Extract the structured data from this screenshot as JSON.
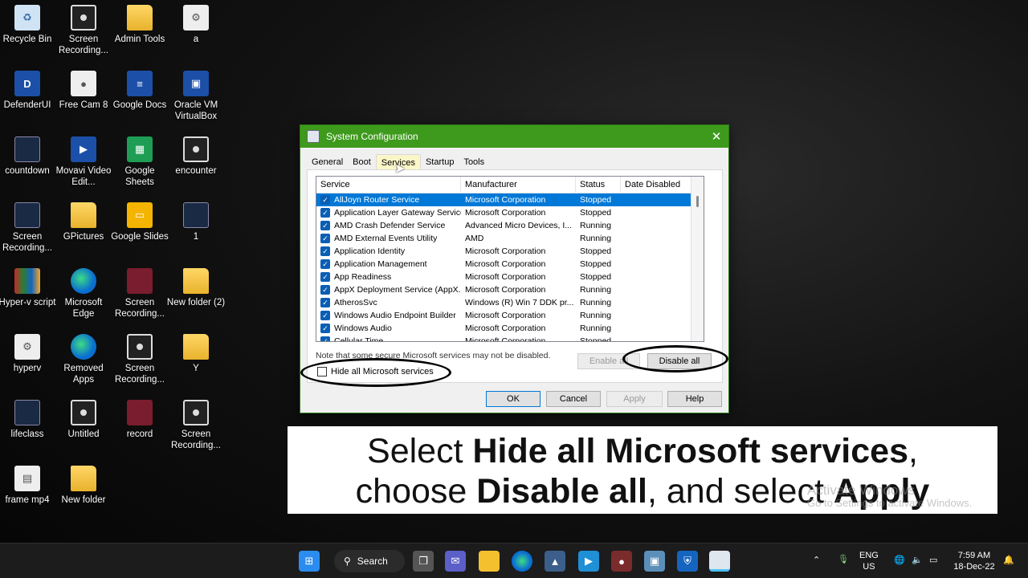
{
  "desktop": {
    "icons": [
      {
        "label": "Recycle Bin",
        "type": "bin",
        "glyph": "♻"
      },
      {
        "label": "Screen Recording...",
        "type": "film",
        "glyph": ""
      },
      {
        "label": "Admin Tools",
        "type": "folder",
        "glyph": ""
      },
      {
        "label": "a",
        "type": "gear",
        "glyph": "⚙"
      },
      {
        "label": "DefenderUI",
        "type": "blue",
        "glyph": "D"
      },
      {
        "label": "Free Cam 8",
        "type": "gear",
        "glyph": "●"
      },
      {
        "label": "Google Docs",
        "type": "blue",
        "glyph": "≡"
      },
      {
        "label": "Oracle VM VirtualBox",
        "type": "blue",
        "glyph": "▣"
      },
      {
        "label": "countdown",
        "type": "dark",
        "glyph": ""
      },
      {
        "label": "Movavi Video Edit...",
        "type": "blue",
        "glyph": "▶"
      },
      {
        "label": "Google Sheets",
        "type": "green",
        "glyph": "▦"
      },
      {
        "label": "encounter",
        "type": "film",
        "glyph": ""
      },
      {
        "label": "Screen Recording...",
        "type": "dark",
        "glyph": ""
      },
      {
        "label": "GPictures",
        "type": "folder",
        "glyph": ""
      },
      {
        "label": "Google Slides",
        "type": "yellow",
        "glyph": "▭"
      },
      {
        "label": "1",
        "type": "dark",
        "glyph": ""
      },
      {
        "label": "Hyper-v script",
        "type": "multi",
        "glyph": ""
      },
      {
        "label": "Microsoft Edge",
        "type": "edge",
        "glyph": ""
      },
      {
        "label": "Screen Recording...",
        "type": "red",
        "glyph": ""
      },
      {
        "label": "New folder (2)",
        "type": "folder",
        "glyph": ""
      },
      {
        "label": "hyperv",
        "type": "gear",
        "glyph": "⚙"
      },
      {
        "label": "Removed Apps",
        "type": "edge",
        "glyph": ""
      },
      {
        "label": "Screen Recording...",
        "type": "film",
        "glyph": ""
      },
      {
        "label": "Y",
        "type": "folder",
        "glyph": ""
      },
      {
        "label": "lifeclass",
        "type": "dark",
        "glyph": ""
      },
      {
        "label": "Untitled",
        "type": "film",
        "glyph": ""
      },
      {
        "label": "record",
        "type": "red",
        "glyph": ""
      },
      {
        "label": "Screen Recording...",
        "type": "film",
        "glyph": ""
      },
      {
        "label": "frame mp4",
        "type": "gear",
        "glyph": "▤"
      },
      {
        "label": "New folder",
        "type": "folder",
        "glyph": ""
      }
    ]
  },
  "dialog": {
    "title": "System Configuration",
    "close_glyph": "✕",
    "tabs": [
      "General",
      "Boot",
      "Services",
      "Startup",
      "Tools"
    ],
    "active_tab": "Services",
    "columns": [
      "Service",
      "Manufacturer",
      "Status",
      "Date Disabled"
    ],
    "rows": [
      {
        "service": "AllJoyn Router Service",
        "manufacturer": "Microsoft Corporation",
        "status": "Stopped"
      },
      {
        "service": "Application Layer Gateway Service",
        "manufacturer": "Microsoft Corporation",
        "status": "Stopped"
      },
      {
        "service": "AMD Crash Defender Service",
        "manufacturer": "Advanced Micro Devices, I...",
        "status": "Running"
      },
      {
        "service": "AMD External Events Utility",
        "manufacturer": "AMD",
        "status": "Running"
      },
      {
        "service": "Application Identity",
        "manufacturer": "Microsoft Corporation",
        "status": "Stopped"
      },
      {
        "service": "Application Management",
        "manufacturer": "Microsoft Corporation",
        "status": "Stopped"
      },
      {
        "service": "App Readiness",
        "manufacturer": "Microsoft Corporation",
        "status": "Stopped"
      },
      {
        "service": "AppX Deployment Service (AppX...",
        "manufacturer": "Microsoft Corporation",
        "status": "Running"
      },
      {
        "service": "AtherosSvc",
        "manufacturer": "Windows (R) Win 7 DDK pr...",
        "status": "Running"
      },
      {
        "service": "Windows Audio Endpoint Builder",
        "manufacturer": "Microsoft Corporation",
        "status": "Running"
      },
      {
        "service": "Windows Audio",
        "manufacturer": "Microsoft Corporation",
        "status": "Running"
      },
      {
        "service": "Cellular Time",
        "manufacturer": "Microsoft Corporation",
        "status": "Stopped"
      }
    ],
    "note": "Note that some secure Microsoft services may not be disabled.",
    "hide_ms_label": "Hide all Microsoft services",
    "enable_all_label": "Enable all",
    "disable_all_label": "Disable all",
    "ok_label": "OK",
    "cancel_label": "Cancel",
    "apply_label": "Apply",
    "help_label": "Help"
  },
  "caption": {
    "p1": "Select ",
    "b1": "Hide all Microsoft services",
    "p2": ",",
    "p3": "choose ",
    "b2": "Disable all",
    "p4": ", and select ",
    "b3": "Apply"
  },
  "watermark": {
    "line1": "Activate Windows",
    "line2": "Go to Settings to activate Windows."
  },
  "taskbar": {
    "search_label": "Search",
    "lang_line1": "ENG",
    "lang_line2": "US",
    "time": "7:59 AM",
    "date": "18-Dec-22"
  }
}
